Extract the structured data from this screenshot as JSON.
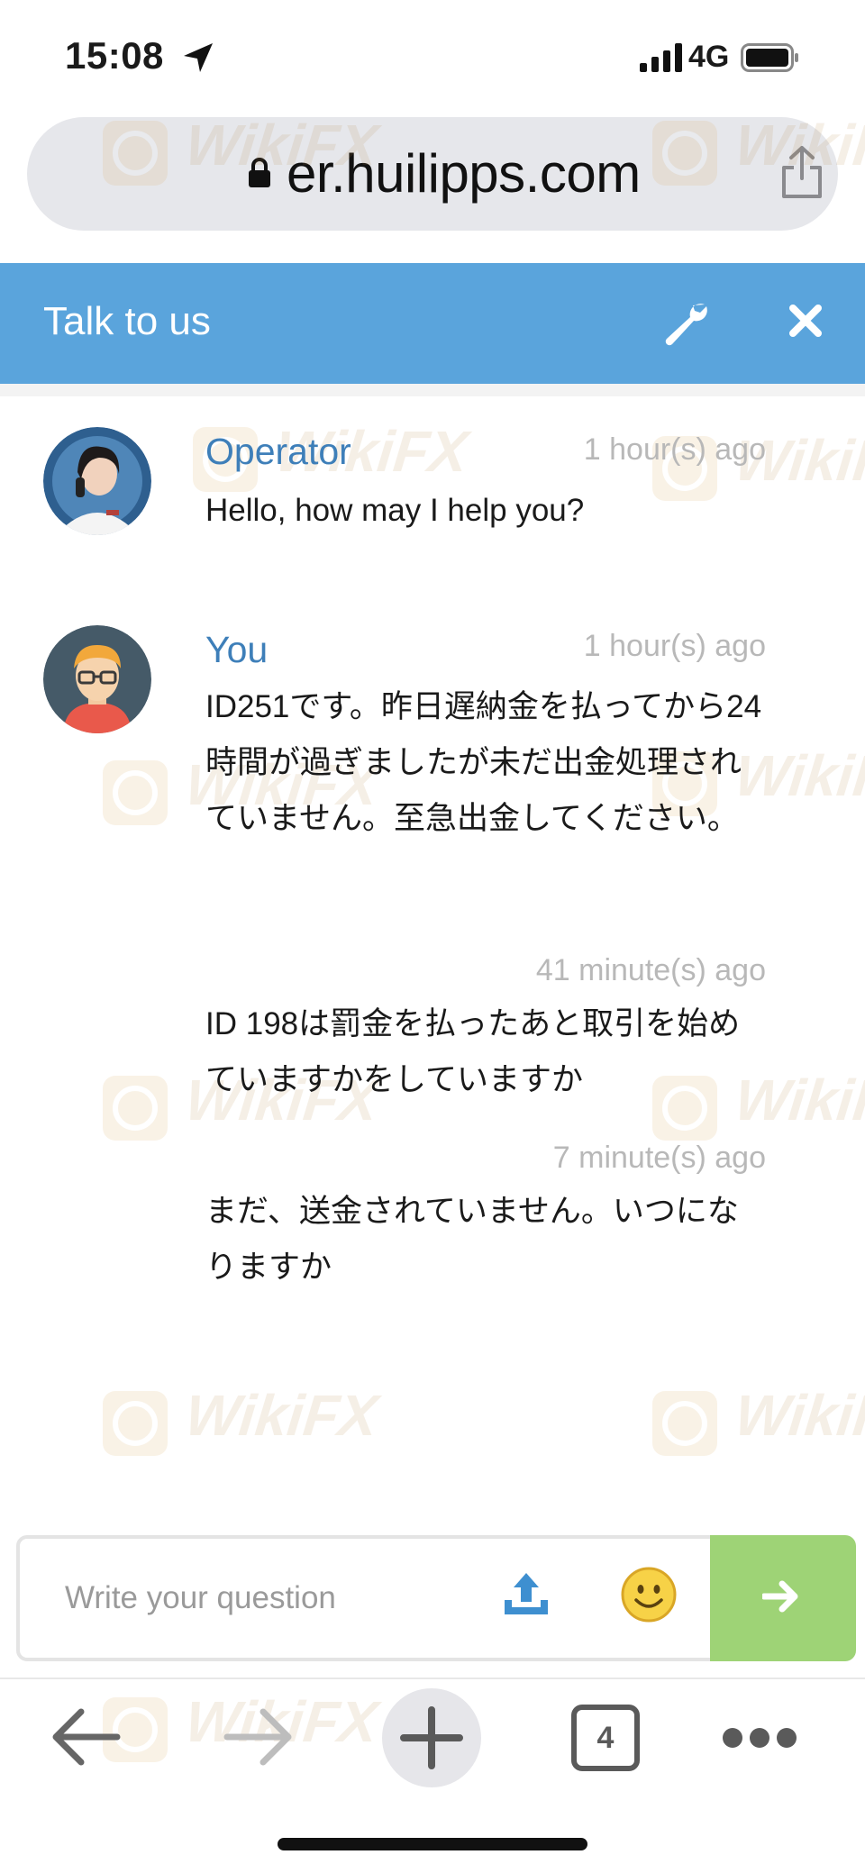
{
  "status_bar": {
    "time": "15:08",
    "network": "4G",
    "icons": [
      "location-arrow-icon",
      "signal-bars-icon",
      "battery-icon"
    ]
  },
  "browser": {
    "url": "er.huilipps.com",
    "icons": [
      "lock-icon",
      "share-icon"
    ]
  },
  "chat": {
    "title": "Talk to us",
    "header_color": "#5aa4dc",
    "icons": [
      "wrench-icon",
      "close-icon"
    ],
    "messages": [
      {
        "sender": "Operator",
        "time": "1 hour(s) ago",
        "text": "Hello, how may I help you?",
        "avatar": "operator-avatar"
      },
      {
        "sender": "You",
        "time": "1 hour(s) ago",
        "text": "ID251です。昨日遅納金を払ってから24時間が過ぎましたが未だ出金処理されていません。至急出金してください。",
        "avatar": "user-avatar"
      },
      {
        "sender": "",
        "time": "41 minute(s) ago",
        "text": "ID 198は罰金を払ったあと取引を始めていますかをしていますか"
      },
      {
        "sender": "",
        "time": "7 minute(s) ago",
        "text": "まだ、送金されていません。いつになりますか"
      }
    ]
  },
  "composer": {
    "placeholder": "Write your question",
    "send_color": "#9ed376",
    "icons": [
      "upload-icon",
      "smiley-icon",
      "send-arrow-icon"
    ]
  },
  "toolbar": {
    "tab_count": "4",
    "icons": [
      "back-arrow-icon",
      "forward-arrow-icon",
      "new-tab-icon",
      "more-icon"
    ]
  },
  "watermark": {
    "text": "WikiFX"
  }
}
